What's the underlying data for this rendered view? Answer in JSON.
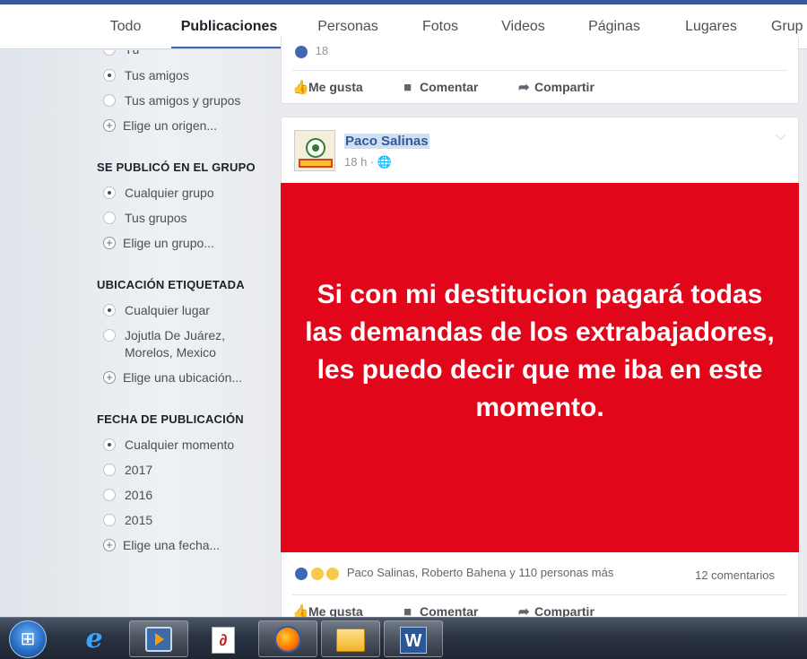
{
  "tabs": [
    {
      "label": "Todo"
    },
    {
      "label": "Publicaciones"
    },
    {
      "label": "Personas"
    },
    {
      "label": "Fotos"
    },
    {
      "label": "Videos"
    },
    {
      "label": "Páginas"
    },
    {
      "label": "Lugares"
    },
    {
      "label": "Grup"
    }
  ],
  "sidebar": {
    "top_options": [
      {
        "label": "Tú"
      },
      {
        "label": "Tus amigos"
      },
      {
        "label": "Tus amigos y grupos"
      }
    ],
    "top_add": "Elige un origen...",
    "group": {
      "heading": "SE PUBLICÓ EN EL GRUPO",
      "options": [
        {
          "label": "Cualquier grupo"
        },
        {
          "label": "Tus grupos"
        }
      ],
      "add": "Elige un grupo..."
    },
    "location": {
      "heading": "UBICACIÓN ETIQUETADA",
      "options": [
        {
          "label": "Cualquier lugar"
        },
        {
          "label": "Jojutla De Juárez,"
        }
      ],
      "option_line2": "Morelos, Mexico",
      "add": "Elige una ubicación..."
    },
    "date": {
      "heading": "FECHA DE PUBLICACIÓN",
      "options": [
        {
          "label": "Cualquier momento"
        },
        {
          "label": "2017"
        },
        {
          "label": "2016"
        },
        {
          "label": "2015"
        }
      ],
      "add": "Elige una fecha..."
    }
  },
  "prev_post": {
    "like_count": "18",
    "actions": {
      "like": "Me gusta",
      "comment": "Comentar",
      "share": "Compartir"
    }
  },
  "post": {
    "author": "Paco Salinas",
    "time": "18 h ·",
    "image_text": "Si con mi destitucion pagará todas las demandas de los extrabajadores, les puedo decir que me iba en este momento.",
    "reactions_text": "Paco Salinas, Roberto Bahena y 110 personas más",
    "comments_text": "12 comentarios",
    "actions": {
      "like": "Me gusta",
      "comment": "Comentar",
      "share": "Compartir"
    }
  },
  "taskbar": {
    "icons": [
      "windows-start-icon",
      "internet-explorer-icon",
      "media-player-icon",
      "pdf-reader-icon",
      "firefox-icon",
      "file-explorer-icon",
      "word-icon"
    ]
  }
}
